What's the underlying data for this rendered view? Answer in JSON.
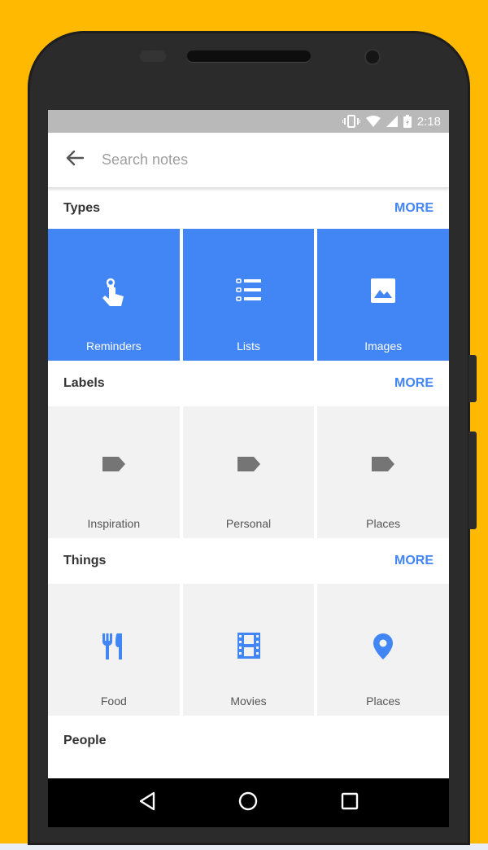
{
  "status": {
    "time": "2:18"
  },
  "search": {
    "placeholder": "Search notes"
  },
  "colors": {
    "accent": "#4285F4",
    "tile_grey": "#f2f2f2",
    "icon_grey": "#757575",
    "background": "#FFB900"
  },
  "sections": {
    "types": {
      "title": "Types",
      "more": "MORE",
      "items": [
        {
          "label": "Reminders",
          "icon": "reminder-hand-icon"
        },
        {
          "label": "Lists",
          "icon": "list-icon"
        },
        {
          "label": "Images",
          "icon": "image-icon"
        }
      ]
    },
    "labels": {
      "title": "Labels",
      "more": "MORE",
      "items": [
        {
          "label": "Inspiration",
          "icon": "label-icon"
        },
        {
          "label": "Personal",
          "icon": "label-icon"
        },
        {
          "label": "Places",
          "icon": "label-icon"
        }
      ]
    },
    "things": {
      "title": "Things",
      "more": "MORE",
      "items": [
        {
          "label": "Food",
          "icon": "restaurant-icon"
        },
        {
          "label": "Movies",
          "icon": "film-icon"
        },
        {
          "label": "Places",
          "icon": "place-pin-icon"
        }
      ]
    },
    "people": {
      "title": "People"
    }
  },
  "navbar": {
    "buttons": [
      "back-triangle-icon",
      "home-circle-icon",
      "recents-square-icon"
    ]
  }
}
